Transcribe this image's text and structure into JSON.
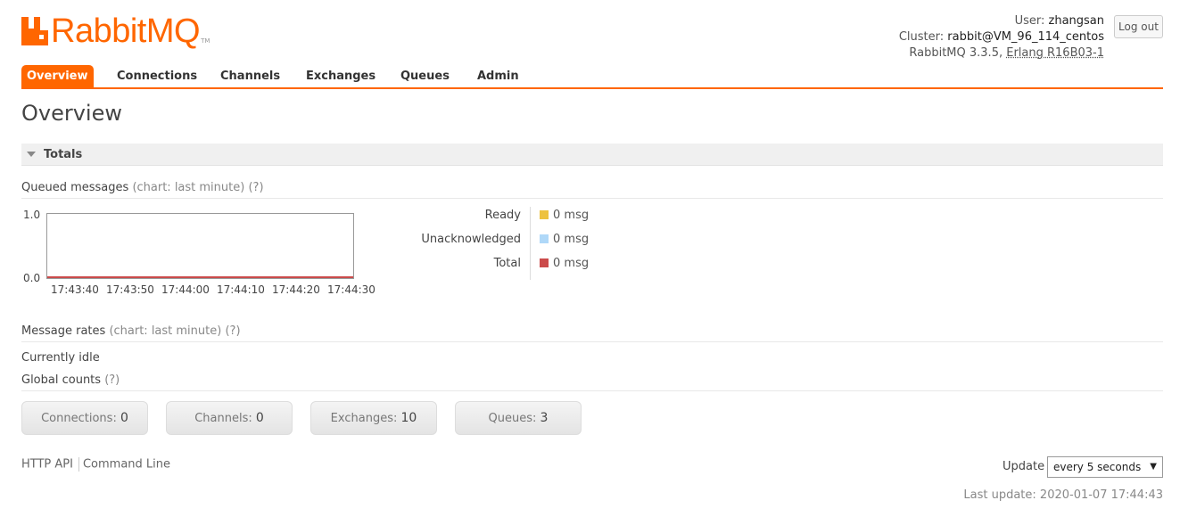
{
  "brand": {
    "logo_text": "RabbitMQ",
    "tm": "TM",
    "color": "#ff6600"
  },
  "login": {
    "user_label": "User:",
    "user": "zhangsan",
    "cluster_label": "Cluster:",
    "cluster": "rabbit@VM_96_114_centos",
    "version": "RabbitMQ 3.3.5,",
    "erlang": "Erlang R16B03-1",
    "logout": "Log out"
  },
  "tabs": [
    {
      "label": "Overview",
      "active": true
    },
    {
      "label": "Connections"
    },
    {
      "label": "Channels"
    },
    {
      "label": "Exchanges"
    },
    {
      "label": "Queues"
    },
    {
      "label": "Admin"
    }
  ],
  "page_title": "Overview",
  "totals": {
    "title": "Totals",
    "queued": {
      "title": "Queued messages",
      "hint": "(chart: last minute)",
      "help": "(?)"
    },
    "rates": {
      "title": "Message rates",
      "hint": "(chart: last minute)",
      "help": "(?)",
      "idle": "Currently idle"
    },
    "global": {
      "title": "Global counts",
      "help": "(?)"
    }
  },
  "chart_data": {
    "type": "line",
    "x": [
      "17:43:40",
      "17:43:50",
      "17:44:00",
      "17:44:10",
      "17:44:20",
      "17:44:30"
    ],
    "yticks": [
      "1.0",
      "0.0"
    ],
    "ylim": [
      0,
      1
    ],
    "series": [
      {
        "name": "Ready",
        "values": [
          0,
          0,
          0,
          0,
          0,
          0
        ],
        "color": "#edc240"
      },
      {
        "name": "Unacknowledged",
        "values": [
          0,
          0,
          0,
          0,
          0,
          0
        ],
        "color": "#afd8f8"
      },
      {
        "name": "Total",
        "values": [
          0,
          0,
          0,
          0,
          0,
          0
        ],
        "color": "#cb4b4b"
      }
    ]
  },
  "legend": [
    {
      "name": "Ready",
      "value": "0 msg",
      "color": "#edc240"
    },
    {
      "name": "Unacknowledged",
      "value": "0 msg",
      "color": "#afd8f8"
    },
    {
      "name": "Total",
      "value": "0 msg",
      "color": "#cb4b4b"
    }
  ],
  "counts": [
    {
      "label": "Connections:",
      "value": "0"
    },
    {
      "label": "Channels:",
      "value": "0"
    },
    {
      "label": "Exchanges:",
      "value": "10"
    },
    {
      "label": "Queues:",
      "value": "3"
    }
  ],
  "footer": {
    "http_api": "HTTP API",
    "command_line": "Command Line"
  },
  "update": {
    "label": "Update",
    "selected": "every 5 seconds",
    "caret": "▼"
  },
  "last_update": "Last update: 2020-01-07 17:44:43"
}
